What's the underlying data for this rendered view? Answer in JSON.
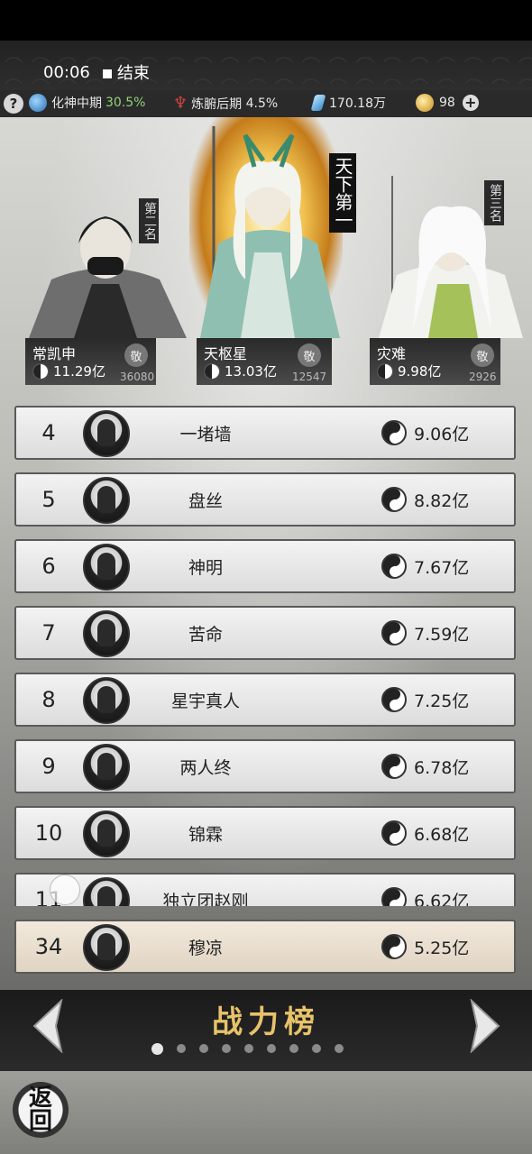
{
  "recording": {
    "time": "00:06",
    "stop_label": "结束"
  },
  "resources": {
    "realm": "化神中期",
    "realm_pct": "30.5%",
    "body": "炼腑后期",
    "body_pct": "4.5%",
    "spirit_stones": "170.18万",
    "currency": "98"
  },
  "top3": [
    {
      "rank_label": "第二名",
      "name": "常凯申",
      "power": "11.29亿",
      "respect": "36080"
    },
    {
      "rank_label": "天下第一",
      "name": "天枢星",
      "power": "13.03亿",
      "respect": "12547"
    },
    {
      "rank_label": "第三名",
      "name": "灾难",
      "power": "9.98亿",
      "respect": "2926"
    }
  ],
  "respect_label": "敬",
  "rows": [
    {
      "rank": "4",
      "name": "一堵墙",
      "power": "9.06亿"
    },
    {
      "rank": "5",
      "name": "盘丝",
      "power": "8.82亿"
    },
    {
      "rank": "6",
      "name": "神明",
      "power": "7.67亿"
    },
    {
      "rank": "7",
      "name": "苦命",
      "power": "7.59亿"
    },
    {
      "rank": "8",
      "name": "星宇真人",
      "power": "7.25亿"
    },
    {
      "rank": "9",
      "name": "两人终",
      "power": "6.78亿"
    },
    {
      "rank": "10",
      "name": "锦霖",
      "power": "6.68亿"
    },
    {
      "rank": "11",
      "name": "独立团赵刚",
      "power": "6.62亿"
    }
  ],
  "my_row": {
    "rank": "34",
    "name": "穆凉",
    "power": "5.25亿"
  },
  "board_title": "战力榜",
  "back_label_top": "返",
  "back_label_bottom": "回"
}
